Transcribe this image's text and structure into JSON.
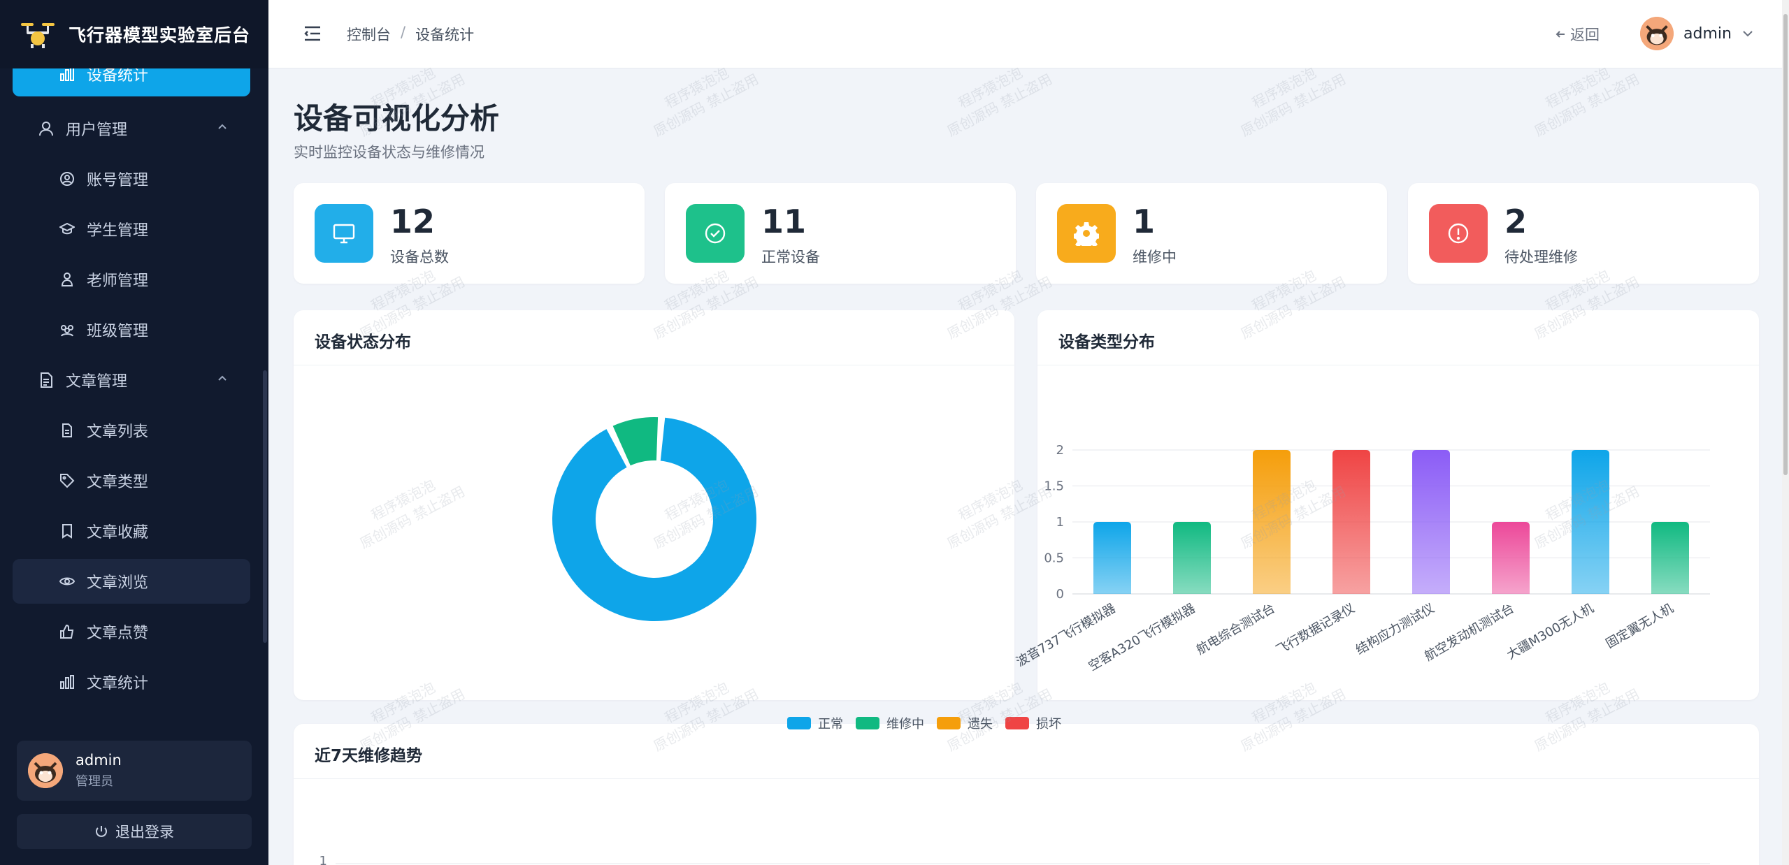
{
  "brand": {
    "title": "飞行器模型实验室后台"
  },
  "sidebar": {
    "items": [
      {
        "label": "设备统计",
        "icon": "bar-chart-icon",
        "level": "sub",
        "state": "active"
      },
      {
        "label": "用户管理",
        "icon": "user-icon",
        "level": "group",
        "expanded": true
      },
      {
        "label": "账号管理",
        "icon": "user-circle-icon",
        "level": "sub"
      },
      {
        "label": "学生管理",
        "icon": "graduation-cap-icon",
        "level": "sub"
      },
      {
        "label": "老师管理",
        "icon": "person-icon",
        "level": "sub"
      },
      {
        "label": "班级管理",
        "icon": "group-icon",
        "level": "sub"
      },
      {
        "label": "文章管理",
        "icon": "document-icon",
        "level": "group",
        "expanded": true
      },
      {
        "label": "文章列表",
        "icon": "file-text-icon",
        "level": "sub"
      },
      {
        "label": "文章类型",
        "icon": "tag-icon",
        "level": "sub"
      },
      {
        "label": "文章收藏",
        "icon": "bookmark-icon",
        "level": "sub"
      },
      {
        "label": "文章浏览",
        "icon": "eye-icon",
        "level": "sub",
        "state": "hover"
      },
      {
        "label": "文章点赞",
        "icon": "thumbs-up-icon",
        "level": "sub"
      },
      {
        "label": "文章统计",
        "icon": "bar-chart-icon",
        "level": "sub"
      }
    ],
    "user": {
      "name": "admin",
      "role": "管理员"
    },
    "logout_label": "退出登录"
  },
  "header": {
    "breadcrumb": [
      "控制台",
      "设备统计"
    ],
    "breadcrumb_sep": "/",
    "back_label": "返回",
    "user_name": "admin"
  },
  "page": {
    "title": "设备可视化分析",
    "subtitle": "实时监控设备状态与维修情况"
  },
  "stats": [
    {
      "value": "12",
      "label": "设备总数",
      "icon": "monitor-icon",
      "color": "#0ea5e9"
    },
    {
      "value": "11",
      "label": "正常设备",
      "icon": "check-circle-icon",
      "color": "#10b981"
    },
    {
      "value": "1",
      "label": "维修中",
      "icon": "gear-icon",
      "color": "#f59e0b"
    },
    {
      "value": "2",
      "label": "待处理维修",
      "icon": "alert-circle-icon",
      "color": "#ef4444"
    }
  ],
  "cards": {
    "status_title": "设备状态分布",
    "type_title": "设备类型分布",
    "trend_title": "近7天维修趋势"
  },
  "watermark": {
    "line1": "程序猿泡泡",
    "line2": "原创源码 禁止盗用"
  },
  "chart_data": [
    {
      "type": "pie",
      "donut": true,
      "categories": [
        "正常",
        "维修中",
        "遗失",
        "损坏"
      ],
      "values": [
        11,
        1,
        0,
        0
      ],
      "colors": [
        "#0ea5e9",
        "#10b981",
        "#f59e0b",
        "#ef4444"
      ],
      "legend": "bottom"
    },
    {
      "type": "bar",
      "categories": [
        "波音737飞行模拟器",
        "空客A320飞行模拟器",
        "航电综合测试台",
        "飞行数据记录仪",
        "结构应力测试仪",
        "航空发动机测试台",
        "大疆M300无人机",
        "固定翼无人机"
      ],
      "values": [
        1,
        1,
        2,
        2,
        2,
        1,
        2,
        1
      ],
      "colors": [
        "#0ea5e9",
        "#10b981",
        "#f59e0b",
        "#ef4444",
        "#8b5cf6",
        "#ec4899",
        "#0ea5e9",
        "#10b981"
      ],
      "yticks": [
        "0",
        "0.5",
        "1",
        "1.5",
        "2"
      ],
      "ylim": [
        0,
        2
      ],
      "grid": true
    },
    {
      "type": "line",
      "yticks": [
        "1"
      ],
      "ylim": [
        0,
        1
      ]
    }
  ]
}
